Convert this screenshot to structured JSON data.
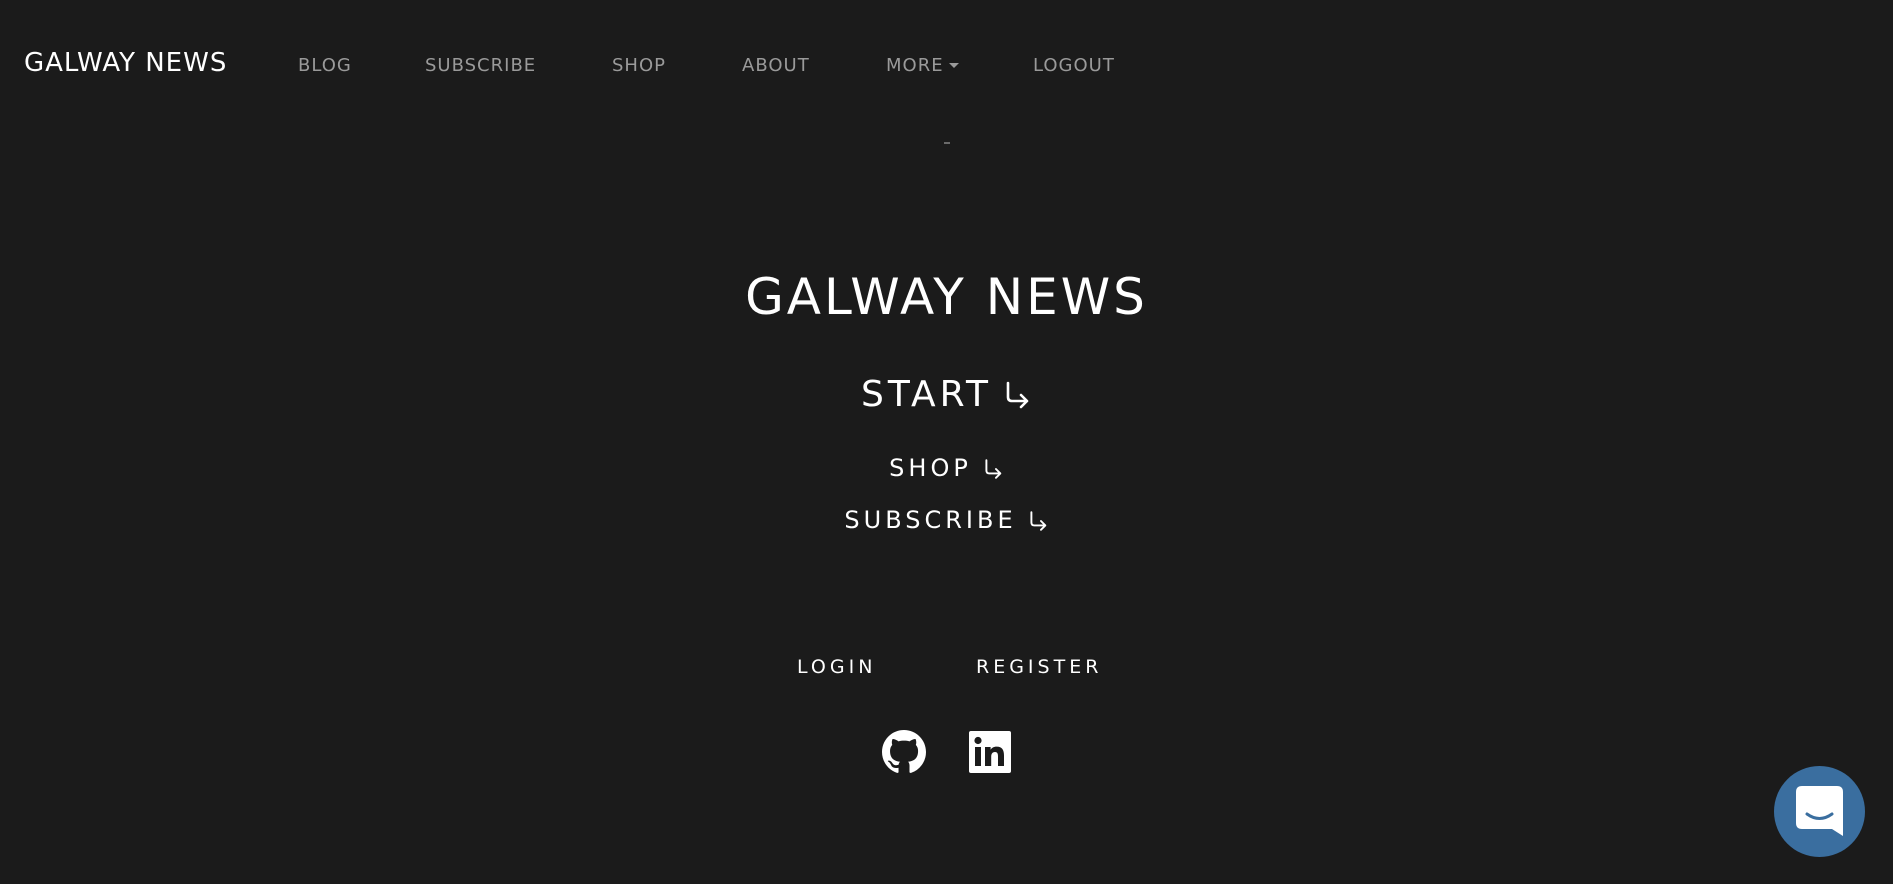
{
  "navbar": {
    "brand": "GALWAY NEWS",
    "links": [
      "BLOG",
      "SUBSCRIBE",
      "SHOP",
      "ABOUT",
      "MORE",
      "LOGOUT"
    ]
  },
  "hero": {
    "title": "GALWAY NEWS",
    "start": "START",
    "shop": "SHOP",
    "subscribe": "SUBSCRIBE"
  },
  "auth": {
    "login": "LOGIN",
    "register": "REGISTER"
  },
  "icons": {
    "arrow": "arrow-down-right-icon",
    "github": "github-icon",
    "linkedin": "linkedin-icon",
    "chat": "chat-icon"
  },
  "colors": {
    "background": "#1b1b1b",
    "nav_text": "#9a9a9a",
    "text": "#ffffff",
    "chat_button": "#3a6e9f"
  }
}
